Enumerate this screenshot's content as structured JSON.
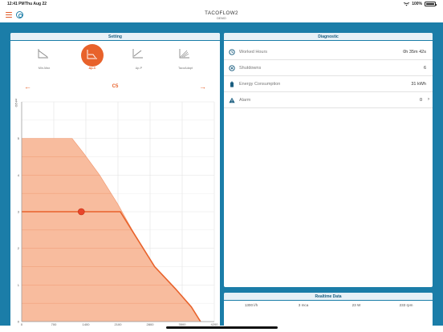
{
  "statusbar": {
    "time": "12:41 PM",
    "date": "Thu Aug 22",
    "battery": "100%"
  },
  "header": {
    "title": "TACOFLOW2",
    "subtitle": "DEMO"
  },
  "setting": {
    "title": "Setting",
    "modes": [
      {
        "label": "Min-Max",
        "icon": "min-max-icon"
      },
      {
        "label": "Δp-C",
        "icon": "dp-c-icon",
        "active": true
      },
      {
        "label": "Δp-P",
        "icon": "dp-p-icon"
      },
      {
        "label": "TacoAdapt",
        "icon": "taco-adapt-icon"
      }
    ],
    "setpoint_label": "C5",
    "accent": "#e8622b"
  },
  "chart_data": {
    "type": "area",
    "y_axis_label": "mH2O",
    "x_axis_label": "l/h",
    "x_ticks": [
      "0",
      "700",
      "1400",
      "2100",
      "2800",
      "3500",
      "4200"
    ],
    "y_ticks": [
      "0",
      "1",
      "2",
      "3",
      "4",
      "5"
    ],
    "xlim": [
      0,
      4200
    ],
    "ylim": [
      0,
      6
    ],
    "envelope": [
      {
        "x": 0,
        "y": 5
      },
      {
        "x": 1100,
        "y": 5
      },
      {
        "x": 1350,
        "y": 4.6
      },
      {
        "x": 1700,
        "y": 4.0
      },
      {
        "x": 2100,
        "y": 3.2
      },
      {
        "x": 2500,
        "y": 2.3
      },
      {
        "x": 2900,
        "y": 1.5
      },
      {
        "x": 3350,
        "y": 0.9
      },
      {
        "x": 3700,
        "y": 0.4
      },
      {
        "x": 3900,
        "y": 0
      }
    ],
    "setpoint_curve": [
      {
        "x": 0,
        "y": 3
      },
      {
        "x": 2150,
        "y": 3
      },
      {
        "x": 2500,
        "y": 2.3
      },
      {
        "x": 2900,
        "y": 1.5
      },
      {
        "x": 3350,
        "y": 0.9
      },
      {
        "x": 3700,
        "y": 0.4
      },
      {
        "x": 3900,
        "y": 0
      }
    ],
    "operating_point": {
      "x": 1300,
      "y": 3
    },
    "fill_color": "#f7b594",
    "line_color": "#e8622b"
  },
  "diagnostic": {
    "title": "Diagnostic",
    "rows": [
      {
        "label": "Worked Hours",
        "value": "0h 35m 42s",
        "icon": "clock-icon"
      },
      {
        "label": "Shutdowns",
        "value": "6",
        "icon": "shutdown-icon"
      },
      {
        "label": "Energy Consumption",
        "value": "31 kWh",
        "icon": "battery-icon"
      },
      {
        "label": "Alarm",
        "value": "0",
        "icon": "alarm-icon",
        "has_chevron": true
      }
    ]
  },
  "realtime": {
    "title": "Realtime Data",
    "values": [
      "1300 l/h",
      "3 mca",
      "23 W",
      "233 rpm"
    ]
  }
}
